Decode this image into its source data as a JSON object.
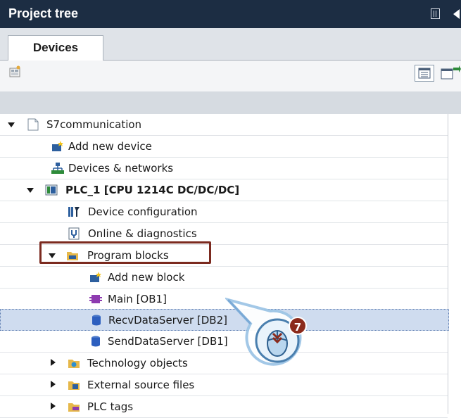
{
  "panel": {
    "title": "Project tree"
  },
  "tabs": [
    {
      "label": "Devices"
    }
  ],
  "tree": {
    "root": "S7communication",
    "add_new_device": "Add new device",
    "devices_networks": "Devices & networks",
    "plc": "PLC_1 [CPU 1214C DC/DC/DC]",
    "device_configuration": "Device configuration",
    "online_diagnostics": "Online & diagnostics",
    "program_blocks": "Program blocks",
    "add_new_block": "Add new block",
    "main": "Main [OB1]",
    "recv_db": "RecvDataServer [DB2]",
    "send_db": "SendDataServer [DB1]",
    "technology_objects": "Technology objects",
    "external_source_files": "External source files",
    "plc_tags": "PLC tags"
  },
  "callout": {
    "step": "7"
  },
  "colors": {
    "titlebar": "#1c2d43",
    "selection": "#cfdcef",
    "highlight_frame": "#7b2a1f",
    "step_badge": "#8b2a1c"
  }
}
